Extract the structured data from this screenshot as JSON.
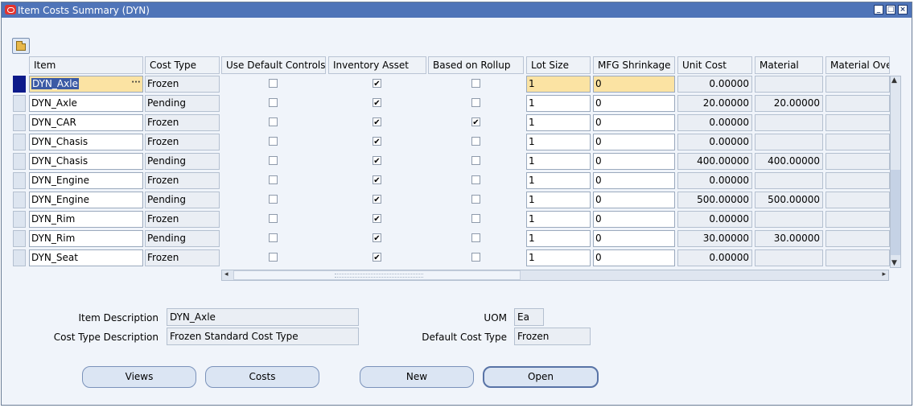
{
  "window": {
    "title": "Item Costs Summary (DYN)"
  },
  "toolbar": {
    "folder_icon": "folder-open-icon"
  },
  "table": {
    "columns": [
      "Item",
      "Cost Type",
      "Use Default Controls",
      "Inventory Asset",
      "Based on Rollup",
      "Lot Size",
      "MFG Shrinkage",
      "Unit Cost",
      "Material",
      "Material Over"
    ],
    "rows": [
      {
        "item": "DYN_Axle",
        "cost_type": "Frozen",
        "use_default": false,
        "inventory_asset": true,
        "based_on_rollup": false,
        "lot_size": "1",
        "mfg_shrinkage": "0",
        "unit_cost": "0.00000",
        "material": ""
      },
      {
        "item": "DYN_Axle",
        "cost_type": "Pending",
        "use_default": false,
        "inventory_asset": true,
        "based_on_rollup": false,
        "lot_size": "1",
        "mfg_shrinkage": "0",
        "unit_cost": "20.00000",
        "material": "20.00000"
      },
      {
        "item": "DYN_CAR",
        "cost_type": "Frozen",
        "use_default": false,
        "inventory_asset": true,
        "based_on_rollup": true,
        "lot_size": "1",
        "mfg_shrinkage": "0",
        "unit_cost": "0.00000",
        "material": ""
      },
      {
        "item": "DYN_Chasis",
        "cost_type": "Frozen",
        "use_default": false,
        "inventory_asset": true,
        "based_on_rollup": false,
        "lot_size": "1",
        "mfg_shrinkage": "0",
        "unit_cost": "0.00000",
        "material": ""
      },
      {
        "item": "DYN_Chasis",
        "cost_type": "Pending",
        "use_default": false,
        "inventory_asset": true,
        "based_on_rollup": false,
        "lot_size": "1",
        "mfg_shrinkage": "0",
        "unit_cost": "400.00000",
        "material": "400.00000"
      },
      {
        "item": "DYN_Engine",
        "cost_type": "Frozen",
        "use_default": false,
        "inventory_asset": true,
        "based_on_rollup": false,
        "lot_size": "1",
        "mfg_shrinkage": "0",
        "unit_cost": "0.00000",
        "material": ""
      },
      {
        "item": "DYN_Engine",
        "cost_type": "Pending",
        "use_default": false,
        "inventory_asset": true,
        "based_on_rollup": false,
        "lot_size": "1",
        "mfg_shrinkage": "0",
        "unit_cost": "500.00000",
        "material": "500.00000"
      },
      {
        "item": "DYN_Rim",
        "cost_type": "Frozen",
        "use_default": false,
        "inventory_asset": true,
        "based_on_rollup": false,
        "lot_size": "1",
        "mfg_shrinkage": "0",
        "unit_cost": "0.00000",
        "material": ""
      },
      {
        "item": "DYN_Rim",
        "cost_type": "Pending",
        "use_default": false,
        "inventory_asset": true,
        "based_on_rollup": false,
        "lot_size": "1",
        "mfg_shrinkage": "0",
        "unit_cost": "30.00000",
        "material": "30.00000"
      },
      {
        "item": "DYN_Seat",
        "cost_type": "Frozen",
        "use_default": false,
        "inventory_asset": true,
        "based_on_rollup": false,
        "lot_size": "1",
        "mfg_shrinkage": "0",
        "unit_cost": "0.00000",
        "material": ""
      }
    ]
  },
  "details": {
    "item_description_label": "Item Description",
    "item_description": "DYN_Axle",
    "cost_type_description_label": "Cost Type Description",
    "cost_type_description": "Frozen Standard Cost Type",
    "uom_label": "UOM",
    "uom": "Ea",
    "default_cost_type_label": "Default Cost Type",
    "default_cost_type": "Frozen"
  },
  "buttons": {
    "views": "Views",
    "costs": "Costs",
    "new": "New",
    "open": "Open"
  }
}
